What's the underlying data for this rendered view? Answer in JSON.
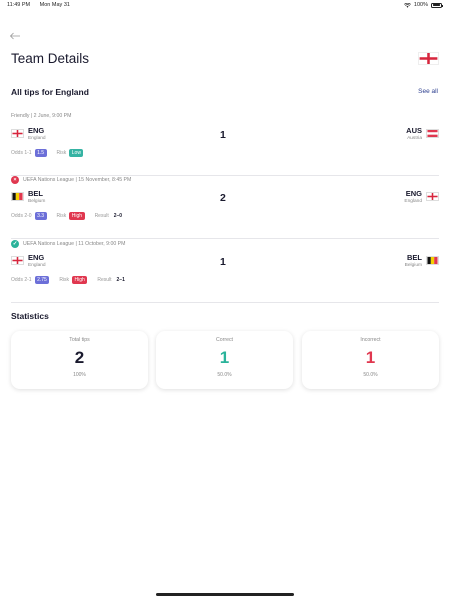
{
  "status_bar": {
    "time": "11:49 PM",
    "date": "Mon May 31",
    "battery": "100%"
  },
  "header": {
    "title": "Team Details",
    "flag": "england-flag-icon"
  },
  "tips_section": {
    "title": "All tips for England",
    "see_all": "See all"
  },
  "tips": [
    {
      "meta": "Friendly | 2 June, 9:00 PM",
      "status": "",
      "home": {
        "code": "ENG",
        "name": "England",
        "flag": "england"
      },
      "away": {
        "code": "AUS",
        "name": "Austria",
        "flag": "austria"
      },
      "score": "1",
      "odds_label": "Odds 1-1",
      "odds": "1.5",
      "risk_label": "Risk",
      "risk": "Low",
      "result_label": "",
      "result": ""
    },
    {
      "meta": "UEFA Nations League | 15 November, 8:45 PM",
      "status": "wrong",
      "home": {
        "code": "BEL",
        "name": "Belgium",
        "flag": "belgium"
      },
      "away": {
        "code": "ENG",
        "name": "England",
        "flag": "england"
      },
      "score": "2",
      "odds_label": "Odds 2-0",
      "odds": "3.3",
      "risk_label": "Risk",
      "risk": "High",
      "result_label": "Result",
      "result": "2–0"
    },
    {
      "meta": "UEFA Nations League | 11 October, 9:00 PM",
      "status": "right",
      "home": {
        "code": "ENG",
        "name": "England",
        "flag": "england"
      },
      "away": {
        "code": "BEL",
        "name": "Belgium",
        "flag": "belgium"
      },
      "score": "1",
      "odds_label": "Odds 2-1",
      "odds": "2.75",
      "risk_label": "Risk",
      "risk": "High",
      "result_label": "Result",
      "result": "2–1"
    }
  ],
  "statistics": {
    "title": "Statistics",
    "cards": [
      {
        "label": "Total tips",
        "value": "2",
        "percent": "100%",
        "color": "#1a1a2e"
      },
      {
        "label": "Correct",
        "value": "1",
        "percent": "50.0%",
        "color": "#2ab39a"
      },
      {
        "label": "Incorrect",
        "value": "1",
        "percent": "50.0%",
        "color": "#e0374f"
      }
    ]
  },
  "colors": {
    "accent": "#2d3f8f",
    "correct": "#2ab39a",
    "incorrect": "#e0374f",
    "odds": "#6c6fd8",
    "low": "#35b3a3"
  }
}
